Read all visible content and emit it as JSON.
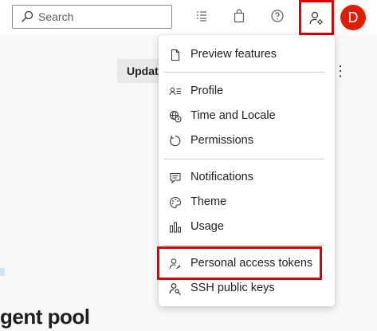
{
  "topbar": {
    "search": {
      "placeholder": "Search",
      "value": ""
    },
    "icons": [
      "list-icon",
      "shopping-bag-icon",
      "help-icon",
      "user-settings-icon"
    ],
    "avatar_initial": "D",
    "avatar_color": "#e01e07"
  },
  "page": {
    "update_label": "Updat",
    "more_icon": "more-vertical-icon",
    "heading": "gent pool"
  },
  "menu": {
    "items": [
      {
        "label": "Preview features",
        "icon": "document-icon"
      },
      {
        "label": "Profile",
        "icon": "profile-card-icon"
      },
      {
        "label": "Time and Locale",
        "icon": "globe-clock-icon"
      },
      {
        "label": "Permissions",
        "icon": "refresh-circle-icon"
      },
      {
        "label": "Notifications",
        "icon": "chat-icon"
      },
      {
        "label": "Theme",
        "icon": "palette-icon"
      },
      {
        "label": "Usage",
        "icon": "bar-chart-icon"
      },
      {
        "label": "Personal access tokens",
        "icon": "person-key-icon"
      },
      {
        "label": "SSH public keys",
        "icon": "person-key-2-icon"
      }
    ]
  },
  "colors": {
    "highlight": "#e00000",
    "accent": "#0078d4"
  }
}
